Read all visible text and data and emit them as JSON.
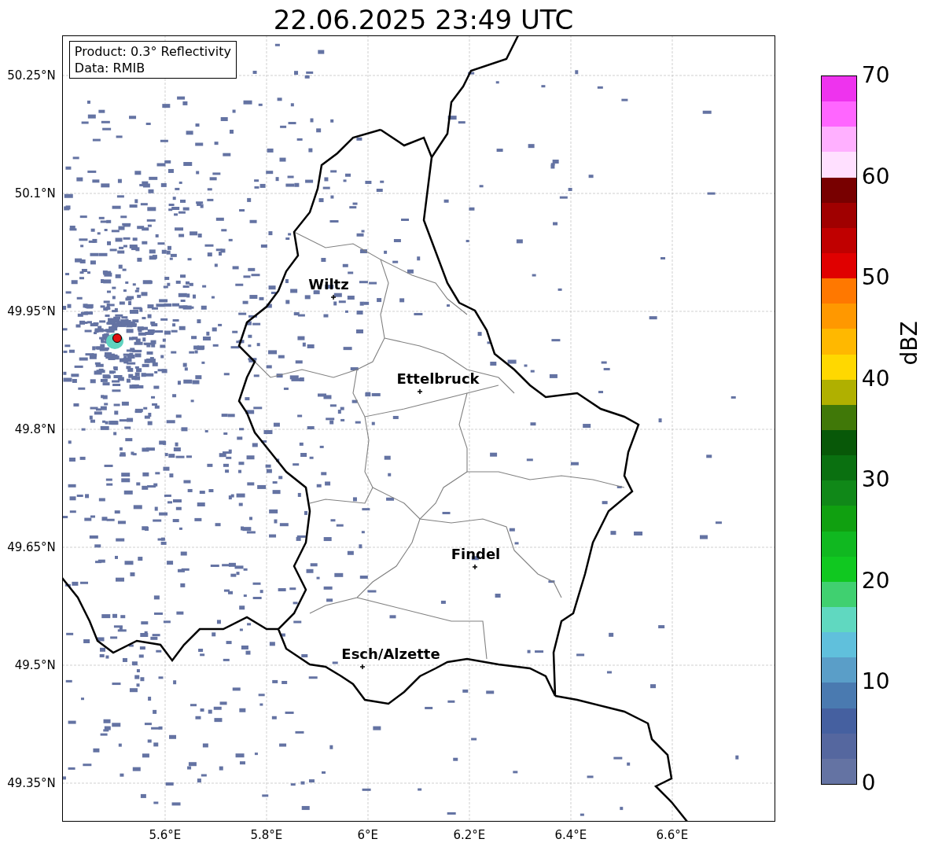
{
  "title": "22.06.2025 23:49 UTC",
  "map": {
    "info_box": [
      "Product: 0.3° Reflectivity",
      "Data: RMIB"
    ],
    "cities": [
      {
        "name": "Wiltz"
      },
      {
        "name": "Ettelbruck"
      },
      {
        "name": "Findel"
      },
      {
        "name": "Esch/Alzette"
      }
    ],
    "y_ticks": [
      "50.25°N",
      "50.1°N",
      "49.95°N",
      "49.8°N",
      "49.65°N",
      "49.5°N",
      "49.35°N"
    ],
    "x_ticks": [
      "5.6°E",
      "5.8°E",
      "6°E",
      "6.2°E",
      "6.4°E",
      "6.6°E"
    ]
  },
  "colorbar": {
    "label": "dBZ",
    "ticks": [
      "70",
      "60",
      "50",
      "40",
      "30",
      "20",
      "10",
      "0"
    ],
    "segments": [
      {
        "color": "#ee33ee"
      },
      {
        "color": "#ff66ff"
      },
      {
        "color": "#ffb0ff"
      },
      {
        "color": "#ffe0ff"
      },
      {
        "color": "#780000"
      },
      {
        "color": "#a00000"
      },
      {
        "color": "#c00000"
      },
      {
        "color": "#e00000"
      },
      {
        "color": "#ff7800"
      },
      {
        "color": "#ff9800"
      },
      {
        "color": "#ffb800"
      },
      {
        "color": "#ffd800"
      },
      {
        "color": "#b0b000"
      },
      {
        "color": "#407808"
      },
      {
        "color": "#085808"
      },
      {
        "color": "#0a7010"
      },
      {
        "color": "#108818"
      },
      {
        "color": "#10a010"
      },
      {
        "color": "#10b820"
      },
      {
        "color": "#10c820"
      },
      {
        "color": "#40d070"
      },
      {
        "color": "#60d8c0"
      },
      {
        "color": "#60c0dc"
      },
      {
        "color": "#5a9ec8"
      },
      {
        "color": "#4a7ab0"
      },
      {
        "color": "#4560a0"
      },
      {
        "color": "#55679f"
      },
      {
        "color": "#6473a3"
      }
    ]
  }
}
